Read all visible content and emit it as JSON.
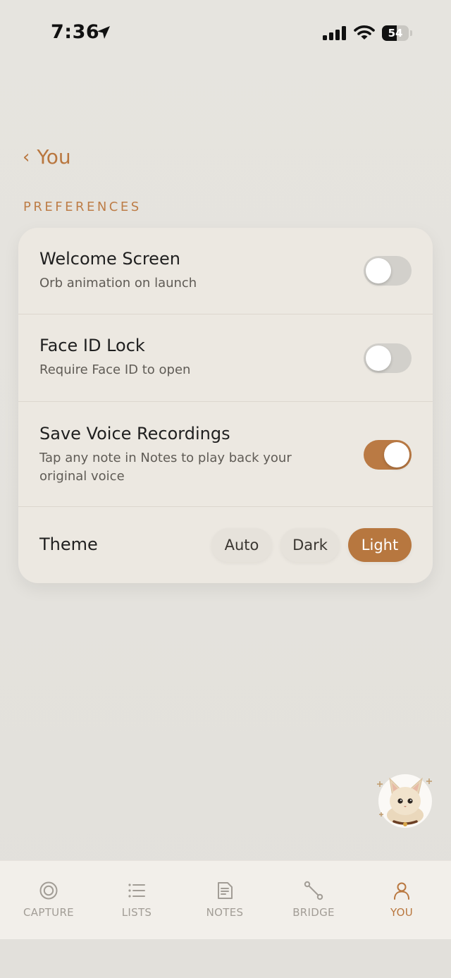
{
  "status_bar": {
    "time": "7:36",
    "battery_text": "54",
    "battery_level": 0.54
  },
  "nav": {
    "back_label": "You"
  },
  "section": {
    "label": "PREFERENCES"
  },
  "preferences": [
    {
      "title": "Welcome Screen",
      "subtitle": "Orb animation on launch",
      "enabled": false
    },
    {
      "title": "Face ID Lock",
      "subtitle": "Require Face ID to open",
      "enabled": false
    },
    {
      "title": "Save Voice Recordings",
      "subtitle": "Tap any note in Notes to play back your original voice",
      "enabled": true
    }
  ],
  "theme": {
    "label": "Theme",
    "options": [
      "Auto",
      "Dark",
      "Light"
    ],
    "selected": "Light"
  },
  "tabs": [
    {
      "label": "CAPTURE",
      "icon": "capture-icon",
      "active": false
    },
    {
      "label": "LISTS",
      "icon": "list-icon",
      "active": false
    },
    {
      "label": "NOTES",
      "icon": "notes-icon",
      "active": false
    },
    {
      "label": "BRIDGE",
      "icon": "bridge-icon",
      "active": false
    },
    {
      "label": "YOU",
      "icon": "person-icon",
      "active": true
    }
  ],
  "colors": {
    "accent": "#b9773f",
    "toggle_off": "#d2d0cb",
    "card": "#ece8e1",
    "tab_inactive": "#a29d96"
  }
}
